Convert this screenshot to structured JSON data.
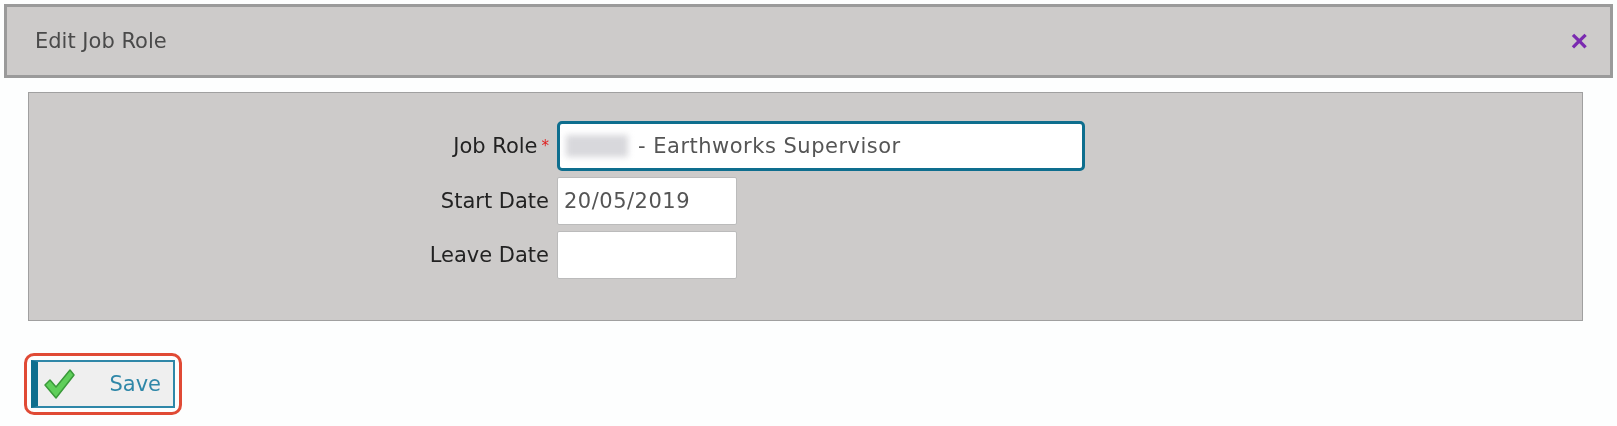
{
  "dialog": {
    "title": "Edit Job Role",
    "close": "×"
  },
  "form": {
    "fields": [
      {
        "label": "Job Role",
        "required": true,
        "required_mark": "*",
        "value": "- Earthworks Supervisor",
        "redacted_prefix": true,
        "focused": true,
        "kind": "wide"
      },
      {
        "label": "Start Date",
        "value": "20/05/2019",
        "focused": false,
        "kind": "date"
      },
      {
        "label": "Leave Date",
        "focused": false,
        "kind": "date"
      }
    ]
  },
  "save_button": {
    "label": "Save",
    "highlighted": true
  }
}
